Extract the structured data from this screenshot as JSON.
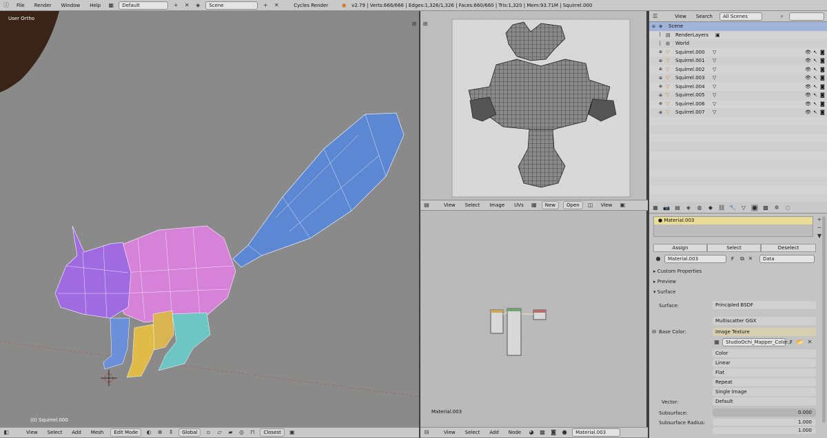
{
  "topbar": {
    "menus": [
      "File",
      "Render",
      "Window",
      "Help"
    ],
    "layout": "Default",
    "scene": "Scene",
    "engine": "Cycles Render",
    "stats": "v2.79 | Verts:666/666 | Edges:1,326/1,326 | Faces:660/660 | Tris:1,320 | Mem:93.71M | Squirrel.000"
  },
  "viewport": {
    "view_name": "User Ortho",
    "object_label": "(0) Squirrel.000",
    "header": {
      "view": "View",
      "select": "Select",
      "add": "Add",
      "mesh": "Mesh",
      "mode": "Edit Mode",
      "orientation": "Global",
      "snap": "Closest"
    }
  },
  "uv_editor": {
    "header": {
      "view": "View",
      "select": "Select",
      "image": "Image",
      "uvs": "UVs",
      "new": "New",
      "open": "Open",
      "view2": "View"
    }
  },
  "node_editor": {
    "material_label": "Material.003",
    "header": {
      "view": "View",
      "select": "Select",
      "add": "Add",
      "node": "Node",
      "material": "Material.003"
    }
  },
  "outliner": {
    "header": {
      "view": "View",
      "search": "Search",
      "filter": "All Scenes"
    },
    "items": [
      {
        "label": "Scene",
        "level": 0
      },
      {
        "label": "RenderLayers",
        "level": 1
      },
      {
        "label": "World",
        "level": 1
      },
      {
        "label": "Squirrel.000",
        "level": 1
      },
      {
        "label": "Squirrel.001",
        "level": 1
      },
      {
        "label": "Squirrel.002",
        "level": 1
      },
      {
        "label": "Squirrel.003",
        "level": 1
      },
      {
        "label": "Squirrel.004",
        "level": 1
      },
      {
        "label": "Squirrel.005",
        "level": 1
      },
      {
        "label": "Squirrel.006",
        "level": 1
      },
      {
        "label": "Squirrel.007",
        "level": 1
      }
    ]
  },
  "properties": {
    "slot_name": "Material.003",
    "assign": "Assign",
    "select": "Select",
    "deselect": "Deselect",
    "material_name": "Material.003",
    "fake_user": "F",
    "data_link": "Data",
    "sections": {
      "custom": "Custom Properties",
      "preview": "Preview",
      "surface": "Surface"
    },
    "surface_label": "Surface:",
    "surface_value": "Principled BSDF",
    "distribution": "Multiscatter GGX",
    "base_color_label": "Base Color:",
    "base_color_value": "Image Texture",
    "image_name": "StudioOchi_Mapper_Color...",
    "image_options": [
      "Color",
      "Linear",
      "Flat",
      "Repeat",
      "Single Image"
    ],
    "vector_label": "Vector:",
    "vector_value": "Default",
    "subsurface_label": "Subsurface:",
    "subsurface_value": "0.000",
    "subsurface_radius_label": "Subsurface Radius:",
    "radius_values": [
      "1.000",
      "1.000"
    ]
  }
}
